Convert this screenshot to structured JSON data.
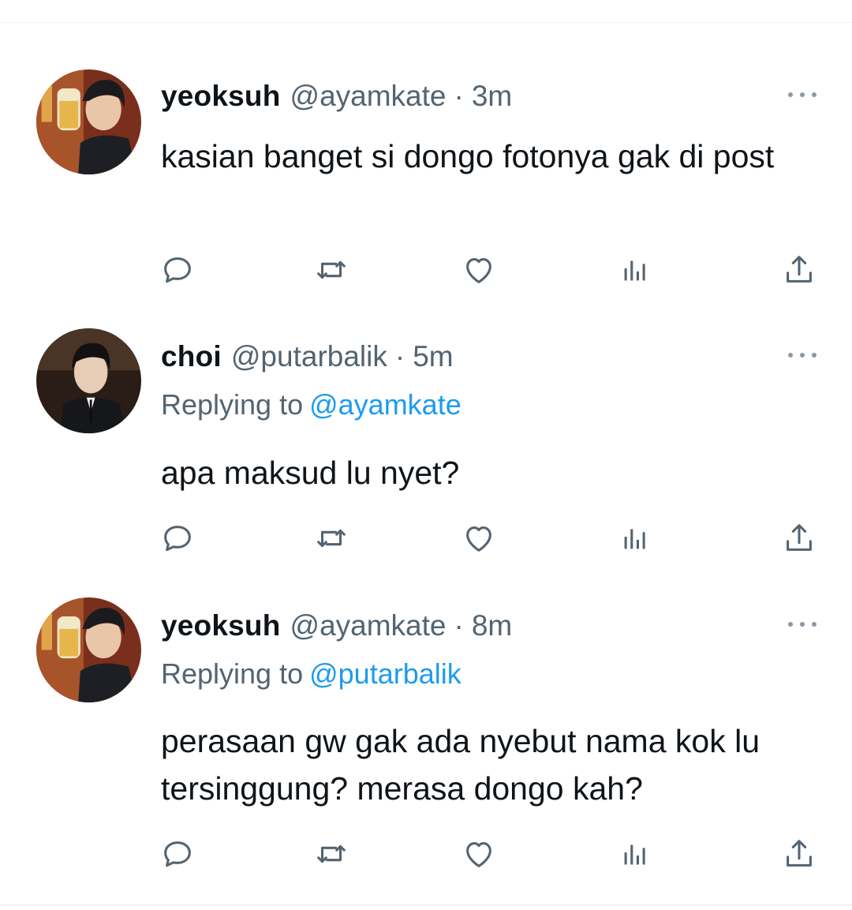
{
  "colors": {
    "text": "#0f1419",
    "secondary": "#536471",
    "accent": "#1d9bf0",
    "icon": "#536471"
  },
  "tweets": [
    {
      "display_name": "yeoksuh",
      "handle": "@ayamkate",
      "separator": "·",
      "time": "3m",
      "replying_prefix": null,
      "replying_to": null,
      "text": "kasian banget si dongo fotonya gak di post",
      "avatar": "avatar-photo-yeoksuh"
    },
    {
      "display_name": "choi",
      "handle": "@putarbalik",
      "separator": "·",
      "time": "5m",
      "replying_prefix": "Replying to",
      "replying_to": "@ayamkate",
      "text": "apa maksud lu nyet?",
      "avatar": "avatar-photo-choi"
    },
    {
      "display_name": "yeoksuh",
      "handle": "@ayamkate",
      "separator": "·",
      "time": "8m",
      "replying_prefix": "Replying to",
      "replying_to": "@putarbalik",
      "text": "perasaan gw gak ada nyebut nama kok lu tersinggung? merasa dongo kah?",
      "avatar": "avatar-photo-yeoksuh"
    }
  ],
  "action_icons": [
    "reply-icon",
    "retweet-icon",
    "like-icon",
    "views-icon",
    "share-icon"
  ]
}
